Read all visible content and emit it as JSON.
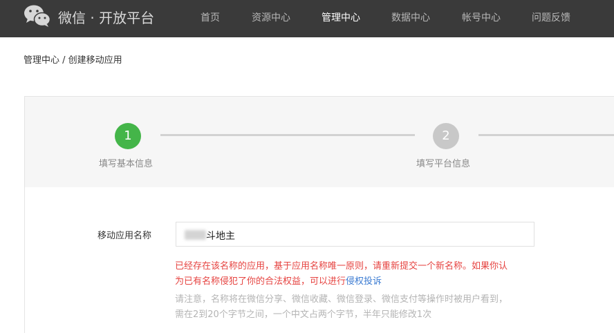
{
  "header": {
    "brand": "微信 · 开放平台",
    "nav": [
      "首页",
      "资源中心",
      "管理中心",
      "数据中心",
      "帐号中心",
      "问题反馈"
    ],
    "active_nav": "管理中心",
    "logo_icon": "wechat-logo-icon"
  },
  "breadcrumb": "管理中心 / 创建移动应用",
  "steps": [
    {
      "number": "1",
      "label": "填写基本信息",
      "state": "done"
    },
    {
      "number": "2",
      "label": "填写平台信息",
      "state": "todo"
    }
  ],
  "form": {
    "name_label": "移动应用名称",
    "name_value": "斗地主",
    "error_line1": "已经存在该名称的应用，基于应用名称唯一原则，请重新提交一个新名称。如果你认",
    "error_line2": "为已有名称侵犯了你的合法权益，可以进行",
    "error_link": "侵权投诉",
    "tip_line1": "请注意，名称将在微信分享、微信收藏、微信登录、微信支付等操作时被用户看到，",
    "tip_line2": "需在2到20个字节之间，一个中文占两个字节，半年只能修改1次"
  },
  "colors": {
    "header_bg": "#3a3a3a",
    "step_done": "#44b549",
    "step_todo": "#c8c8c8",
    "error": "#e64340",
    "link": "#3b7bd2",
    "tip": "#b4b4b4"
  }
}
